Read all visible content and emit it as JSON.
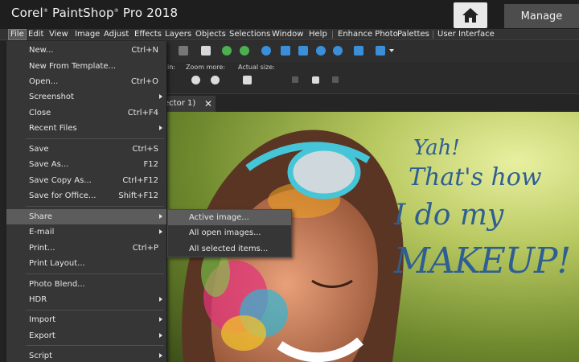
{
  "titlebar": {
    "title_main": "Corel",
    "title_reg": "®",
    "title_rest": " PaintShop",
    "title_reg2": "®",
    "title_end": " Pro 2018",
    "home_icon": "home-icon",
    "manage_label": "Manage"
  },
  "menubar": {
    "items": [
      "File",
      "Edit",
      "View",
      "Image",
      "Adjust",
      "Effects",
      "Layers",
      "Objects",
      "Selections",
      "Window",
      "Help",
      "Enhance Photo",
      "Palettes",
      "User Interface"
    ]
  },
  "tool_options": {
    "label_in": "in:",
    "zoom_more": "Zoom more:",
    "actual_size": "Actual size:"
  },
  "document_tab": {
    "label": "ector 1)",
    "close": "✕"
  },
  "canvas_text": {
    "line1": "Yah!",
    "line2": "That's how",
    "line3": "I do my",
    "line4": "MAKEUP!"
  },
  "file_menu": {
    "items": [
      {
        "label": "New...",
        "shortcut": "Ctrl+N"
      },
      {
        "label": "New From Template...",
        "shortcut": ""
      },
      {
        "label": "Open...",
        "shortcut": "Ctrl+O"
      },
      {
        "label": "Screenshot",
        "shortcut": ""
      },
      {
        "label": "Close",
        "shortcut": "Ctrl+F4"
      },
      {
        "label": "Recent Files",
        "shortcut": ""
      },
      {
        "label": "Save",
        "shortcut": "Ctrl+S"
      },
      {
        "label": "Save As...",
        "shortcut": "F12"
      },
      {
        "label": "Save Copy As...",
        "shortcut": "Ctrl+F12"
      },
      {
        "label": "Save for Office...",
        "shortcut": "Shift+F12"
      },
      {
        "label": "Share",
        "shortcut": ""
      },
      {
        "label": "E-mail",
        "shortcut": ""
      },
      {
        "label": "Print...",
        "shortcut": "Ctrl+P"
      },
      {
        "label": "Print Layout...",
        "shortcut": ""
      },
      {
        "label": "Photo Blend...",
        "shortcut": ""
      },
      {
        "label": "HDR",
        "shortcut": ""
      },
      {
        "label": "Import",
        "shortcut": ""
      },
      {
        "label": "Export",
        "shortcut": ""
      },
      {
        "label": "Script",
        "shortcut": ""
      }
    ]
  },
  "share_submenu": {
    "items": [
      "Active image...",
      "All open images...",
      "All selected items..."
    ]
  },
  "colors": {
    "menu_bg": "#363636",
    "highlight": "#5c5c5c",
    "text_blue": "#2f5f92"
  }
}
